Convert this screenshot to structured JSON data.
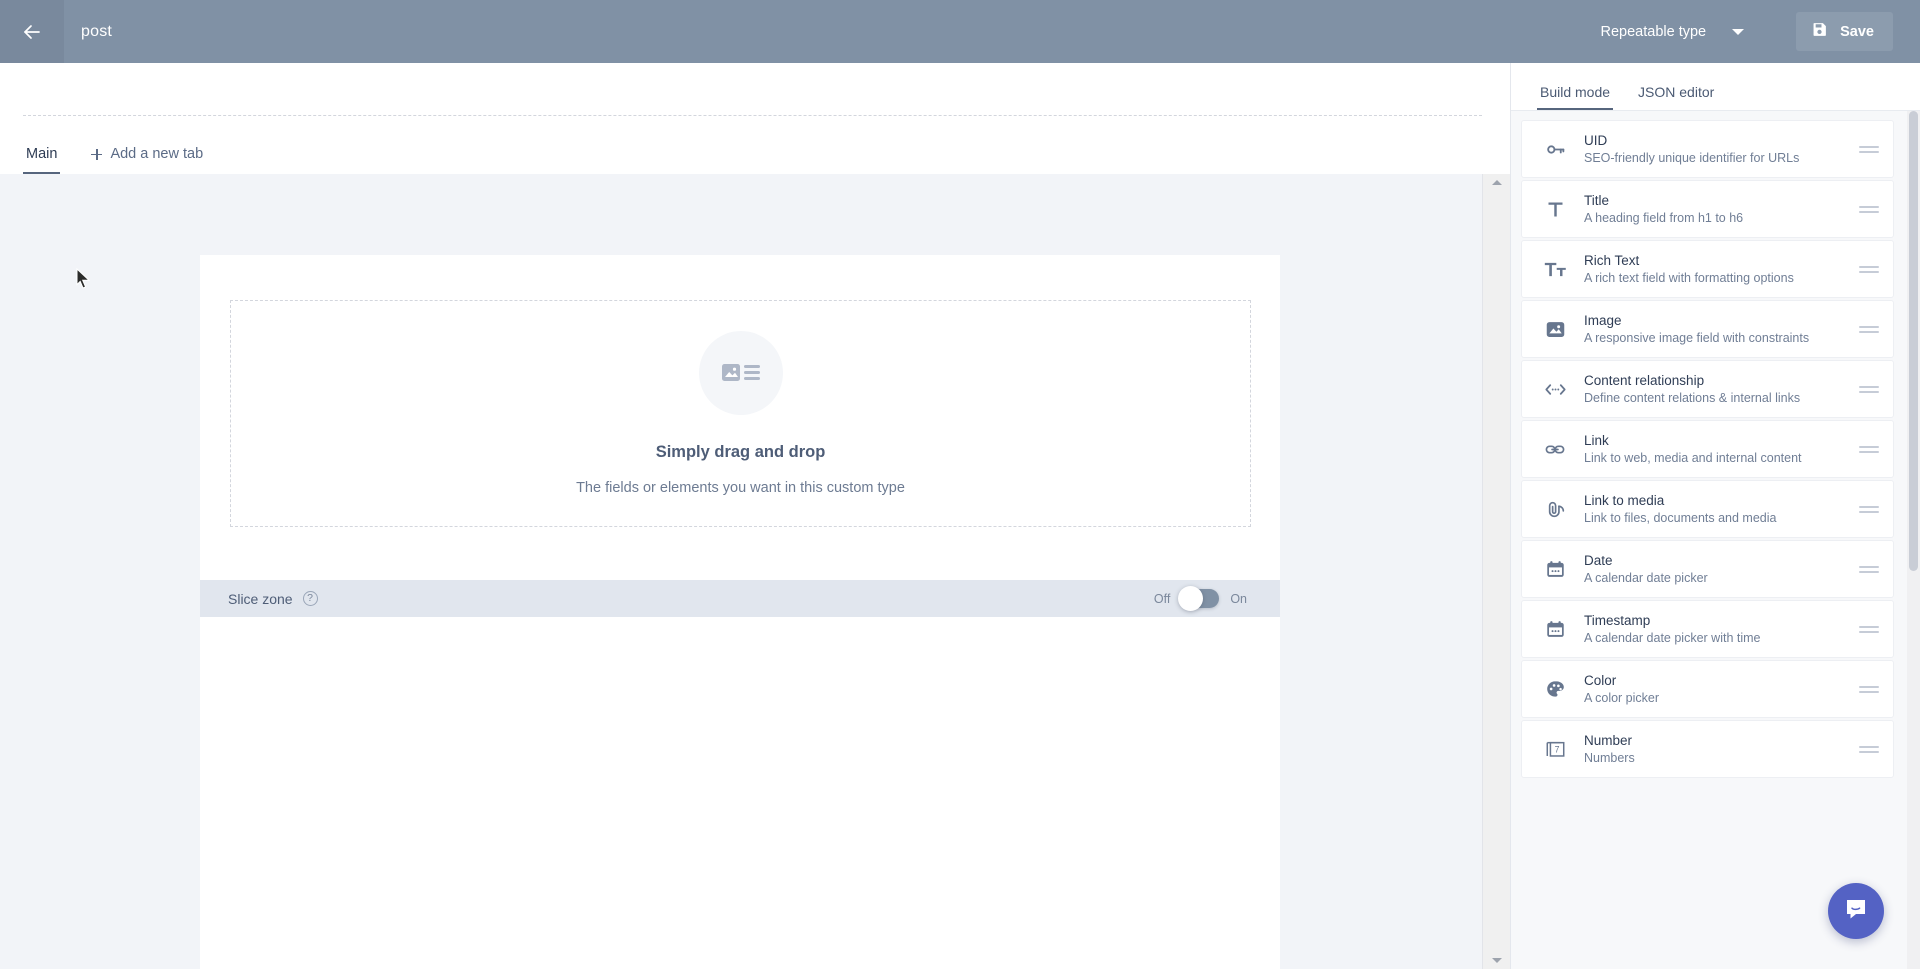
{
  "topbar": {
    "back_icon": "arrow-left-icon",
    "title": "post",
    "type_select": {
      "label": "Repeatable type",
      "icon": "chevron-down-icon"
    },
    "save": {
      "label": "Save",
      "icon": "floppy-disk-icon"
    },
    "bg_color": "#8091a5"
  },
  "tabs": [
    {
      "label": "Main",
      "active": true
    },
    {
      "label": "Add a new tab",
      "active": false,
      "icon": "plus-icon"
    }
  ],
  "dropzone": {
    "icon": "image-and-list-icon",
    "title": "Simply drag and drop",
    "subtitle": "The fields or elements you want in this custom type"
  },
  "slice_zone": {
    "label": "Slice zone",
    "help_icon": "question-mark-circle-icon",
    "toggle": {
      "off_label": "Off",
      "on_label": "On",
      "state": "off"
    }
  },
  "right_panel": {
    "tabs": [
      {
        "label": "Build mode",
        "active": true
      },
      {
        "label": "JSON editor",
        "active": false
      }
    ],
    "fields": [
      {
        "title": "UID",
        "desc": "SEO-friendly unique identifier for URLs",
        "icon": "key-icon"
      },
      {
        "title": "Title",
        "desc": "A heading field from h1 to h6",
        "icon": "title-t-icon"
      },
      {
        "title": "Rich Text",
        "desc": "A rich text field with formatting options",
        "icon": "rich-text-tt-icon"
      },
      {
        "title": "Image",
        "desc": "A responsive image field with constraints",
        "icon": "image-icon"
      },
      {
        "title": "Content relationship",
        "desc": "Define content relations & internal links",
        "icon": "angle-brackets-icon"
      },
      {
        "title": "Link",
        "desc": "Link to web, media and internal content",
        "icon": "chain-link-icon"
      },
      {
        "title": "Link to media",
        "desc": "Link to files, documents and media",
        "icon": "paperclip-icon"
      },
      {
        "title": "Date",
        "desc": "A calendar date picker",
        "icon": "calendar-icon"
      },
      {
        "title": "Timestamp",
        "desc": "A calendar date picker with time",
        "icon": "calendar-clock-icon"
      },
      {
        "title": "Color",
        "desc": "A color picker",
        "icon": "palette-icon"
      },
      {
        "title": "Number",
        "desc": "Numbers",
        "icon": "number-seven-icon"
      }
    ]
  },
  "chat": {
    "icon": "chat-bubble-icon",
    "color": "#5462c4"
  }
}
